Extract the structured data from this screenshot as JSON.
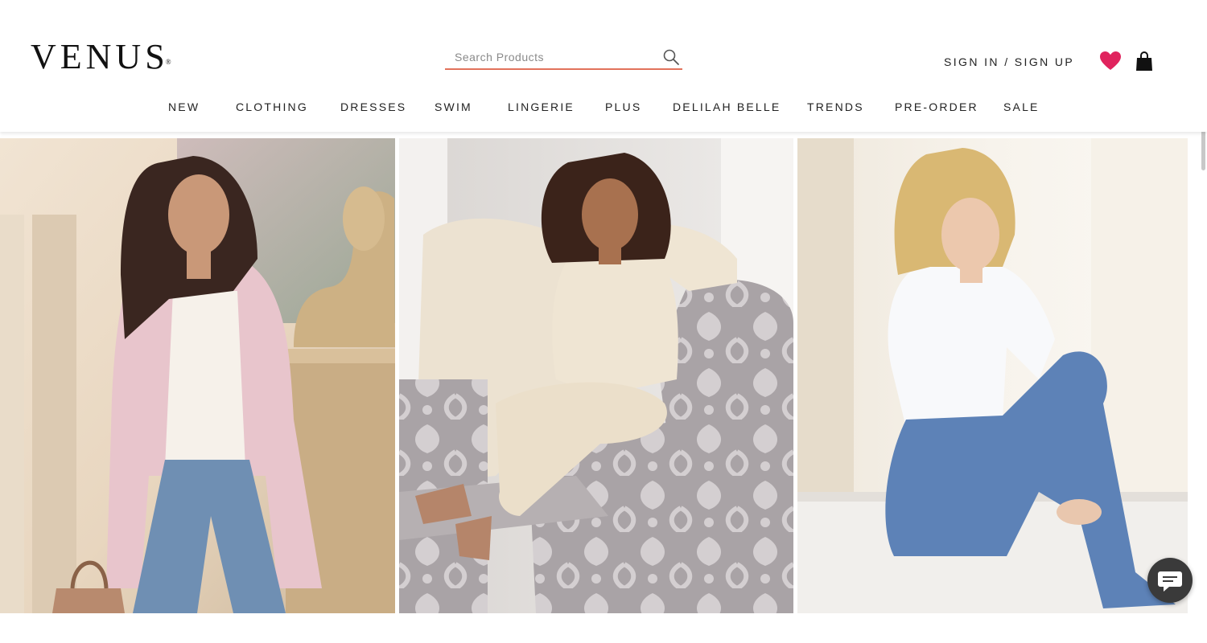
{
  "brand": {
    "logo_text": "VENUS",
    "trademark": "®"
  },
  "search": {
    "placeholder": "Search Products",
    "value": "",
    "icon": "magnifier-icon"
  },
  "account": {
    "signin_label": "SIGN IN / SIGN UP"
  },
  "icons": {
    "wishlist": "heart-icon",
    "cart": "shopping-bag-icon",
    "chat": "chat-bubble-icon"
  },
  "nav": {
    "items": [
      {
        "label": "NEW"
      },
      {
        "label": "CLOTHING"
      },
      {
        "label": "DRESSES"
      },
      {
        "label": "SWIM"
      },
      {
        "label": "LINGERIE"
      },
      {
        "label": "PLUS"
      },
      {
        "label": "DELILAH BELLE"
      },
      {
        "label": "TRENDS"
      },
      {
        "label": "PRE-ORDER"
      },
      {
        "label": "SALE"
      }
    ]
  },
  "colors": {
    "accent_underline": "#e2725b",
    "heart": "#e0245e",
    "text": "#222222",
    "chat_button": "#3a3a3a"
  },
  "banners": [
    {
      "description_key": "model-pink-coat-jeans"
    },
    {
      "description_key": "model-cream-knit-armchair"
    },
    {
      "description_key": "model-white-shirt-flare-jeans"
    }
  ]
}
